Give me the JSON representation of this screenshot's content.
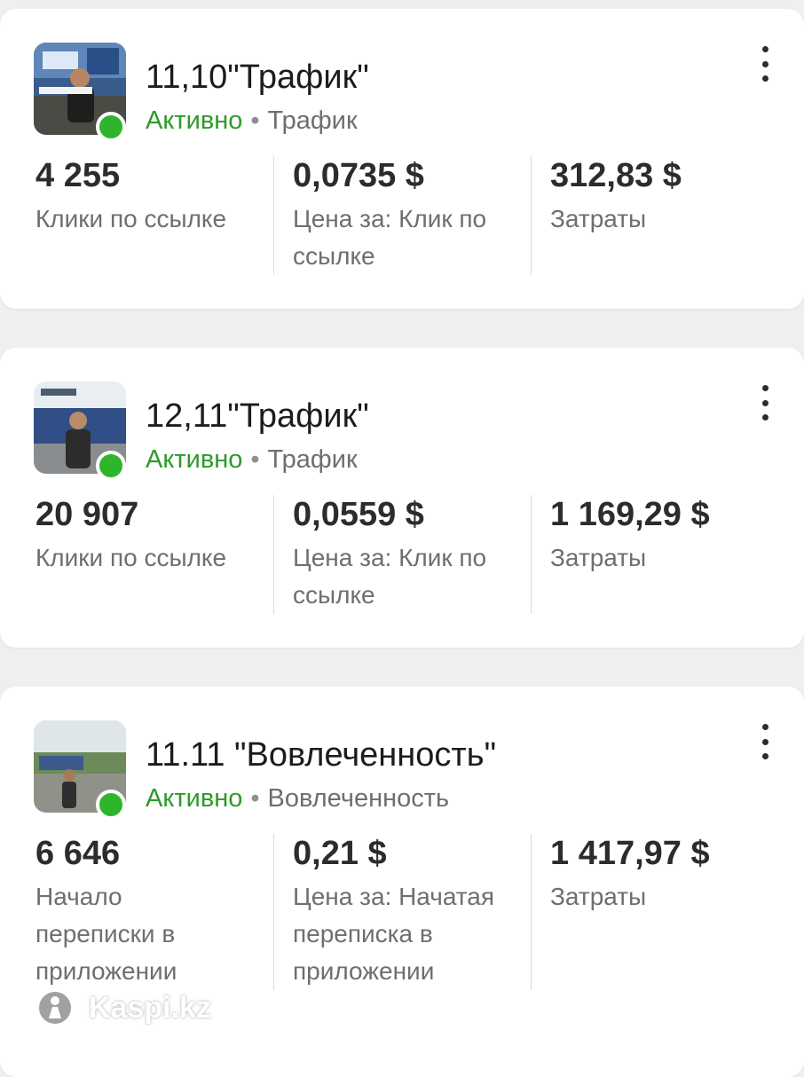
{
  "campaigns": [
    {
      "title": "11,10\"Трафик\"",
      "status": "Активно",
      "separator": "•",
      "objective": "Трафик",
      "metrics": [
        {
          "value": "4 255",
          "label": "Клики по ссылке"
        },
        {
          "value": "0,0735 $",
          "label": "Цена за: Клик по ссылке"
        },
        {
          "value": "312,83 $",
          "label": "Затраты"
        }
      ]
    },
    {
      "title": "12,11\"Трафик\"",
      "status": "Активно",
      "separator": "•",
      "objective": "Трафик",
      "metrics": [
        {
          "value": "20 907",
          "label": "Клики по ссылке"
        },
        {
          "value": "0,0559 $",
          "label": "Цена за: Клик по ссылке"
        },
        {
          "value": "1 169,29 $",
          "label": "Затраты"
        }
      ]
    },
    {
      "title": "11.11 \"Вовлеченность\"",
      "status": "Активно",
      "separator": "•",
      "objective": "Вовлеченность",
      "metrics": [
        {
          "value": "6 646",
          "label": "Начало переписки в приложении"
        },
        {
          "value": "0,21 $",
          "label": "Цена за: Начатая переписка в приложении"
        },
        {
          "value": "1 417,97 $",
          "label": "Затраты"
        }
      ]
    }
  ],
  "watermark": {
    "text": "Kaspi.kz",
    "icon": "kaspi-logo-icon"
  },
  "colors": {
    "status_active": "#2fb52c",
    "status_text": "#2d9a2a",
    "background": "#efeff1"
  }
}
